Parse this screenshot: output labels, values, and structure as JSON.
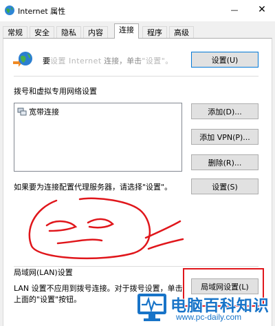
{
  "window": {
    "title": "Internet 属性",
    "minimize_glyph": "—",
    "close_glyph": "✕"
  },
  "tabs": [
    {
      "label": "常规"
    },
    {
      "label": "安全"
    },
    {
      "label": "隐私"
    },
    {
      "label": "内容"
    },
    {
      "label": "连接",
      "active": true
    },
    {
      "label": "程序"
    },
    {
      "label": "高级"
    }
  ],
  "setup": {
    "text_prefix": "要",
    "text_obscured": "设置 Internet",
    "text_middle": " 连接，单击",
    "text_suffix": "\"设置\"。",
    "button_label": "设置(U)"
  },
  "dialup": {
    "heading": "拨号和虚拟专用网络设置",
    "list_items": [
      {
        "label": "宽带连接"
      }
    ],
    "add_button": "添加(D)...",
    "add_vpn_button": "添加 VPN(P)...",
    "remove_button": "删除(R)...",
    "proxy_text": "如果要为连接配置代理服务器，请选择\"设置\"。",
    "settings_button": "设置(S)"
  },
  "lan": {
    "heading": "局域网(LAN)设置",
    "description_line1": "LAN 设置不应用到拨号连接。对于拨号设置，单击",
    "description_line2": "上面的\"设置\"按钮。",
    "button_label": "局域网设置(L)"
  },
  "watermark": {
    "title": "电脑百科知识",
    "url": "www.pc-daily.com"
  },
  "colors": {
    "annotation_red": "#e0161b",
    "watermark_blue": "#1874c8",
    "focus_blue": "#0078d7"
  }
}
